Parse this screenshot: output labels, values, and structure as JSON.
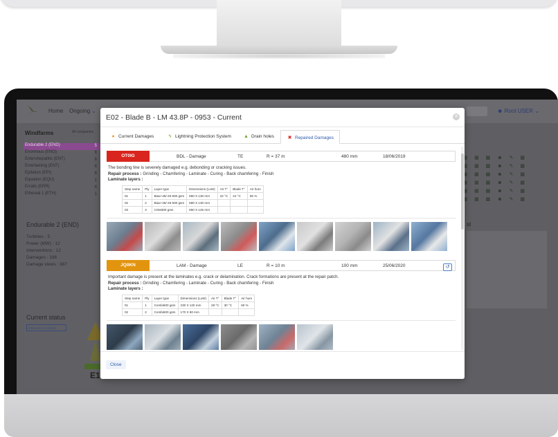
{
  "app": {
    "nav_home": "Home",
    "nav_ongoing": "Ongoing",
    "user": "Root USER",
    "sidebar_title": "Windfarms",
    "sidebar_tag": "All companies",
    "windfarms": [
      {
        "label": "Endurable 2 (END)",
        "count": "5",
        "active": true
      },
      {
        "label": "Enormous (ENO)",
        "count": "6"
      },
      {
        "label": "Enterohepatitis (ENT)",
        "count": "6"
      },
      {
        "label": "Entertaining (ENT)",
        "count": "6"
      },
      {
        "label": "Epilation (EPI)",
        "count": "6"
      },
      {
        "label": "Equation (EQU)",
        "count": "1"
      },
      {
        "label": "Erratic (ERR)",
        "count": "4"
      },
      {
        "label": "Ethereal 1 (ETH)",
        "count": "1"
      }
    ],
    "selected_name": "Endurable 2 (END)",
    "stats": [
      "Turbines : 5",
      "Power (MW) : 12",
      "Interventions : 12",
      "Damages : 186",
      "Damage views : 387"
    ],
    "status_title": "Current status",
    "status_button": "Interventions details",
    "bg_list_title": "st",
    "gauge_label": "E1",
    "colors": {
      "active_purple": "#9c27b0",
      "accent_blue": "#2e5aa8"
    }
  },
  "modal": {
    "title": "E02 - Blade B - LM 43.8P - 0953 - Current",
    "tabs": [
      {
        "label": "Current Damages",
        "icon": "flame-icon",
        "color": "#e9a23b"
      },
      {
        "label": "Lightning Protection System",
        "icon": "lightning-icon",
        "color": "#6aa531"
      },
      {
        "label": "Drain holes",
        "icon": "drop-icon",
        "color": "#6aa531"
      },
      {
        "label": "Repaired Damages",
        "icon": "wrench-cross-icon",
        "color": "#d9251e",
        "active": true
      }
    ],
    "damages": [
      {
        "code": "OT0IG",
        "code_color": "#d9251e",
        "type": "BDL - Damage",
        "edge": "TE",
        "radius": "R = 37 m",
        "size": "480 mm",
        "date": "18/06/2019",
        "description": "The bonding line is severely damaged e.g. debonding or cracking issues.",
        "repair_label": "Repair process :",
        "repair_text": "Grinding - Chamfering - Laminate - Curing - Back chamfering - Finish",
        "laminate_label": "Laminate layers :",
        "columns": [
          "Step name",
          "Ply",
          "Layer type",
          "Dimensions (LxW)",
          "Air T°",
          "Blade T°",
          "Air hum"
        ],
        "rows": [
          [
            "01",
            "1",
            "Biax+45/-45 600 gsm",
            "650 X 130 mm",
            "22 °C",
            "24 °C",
            "55 %"
          ],
          [
            "02",
            "2",
            "Biax+45/-45 600 gsm",
            "580 X 130 mm",
            "",
            "",
            ""
          ],
          [
            "03",
            "3",
            "CSM300 gsm",
            "650 X 145 mm",
            "",
            "",
            ""
          ]
        ],
        "photo_count": 9
      },
      {
        "code": "JQ0KN",
        "code_color": "#e3940f",
        "type": "LAM - Damage",
        "edge": "LE",
        "radius": "R = 10 m",
        "size": "100 mm",
        "date": "25/06/2020",
        "description": "Important damage is present at the laminates e.g. crack or delamination. Crack formations are present at the repair patch.",
        "repair_label": "Repair process :",
        "repair_text": "Grinding - Chamfering - Laminate - Curing - Back chamfering - Finish",
        "laminate_label": "Laminate layers :",
        "columns": [
          "Step name",
          "Ply",
          "Layer type",
          "Dimensions (LxW)",
          "Air T°",
          "Blade T°",
          "Air hum"
        ],
        "rows": [
          [
            "01",
            "1",
            "Combi600 gsm",
            "230 X 120 mm",
            "28 °C",
            "30 °C",
            "60 %"
          ],
          [
            "02",
            "2",
            "Combi600 gsm",
            "170 X 90 mm",
            "",
            "",
            ""
          ]
        ],
        "photo_count": 6
      }
    ],
    "close_label": "Close"
  }
}
